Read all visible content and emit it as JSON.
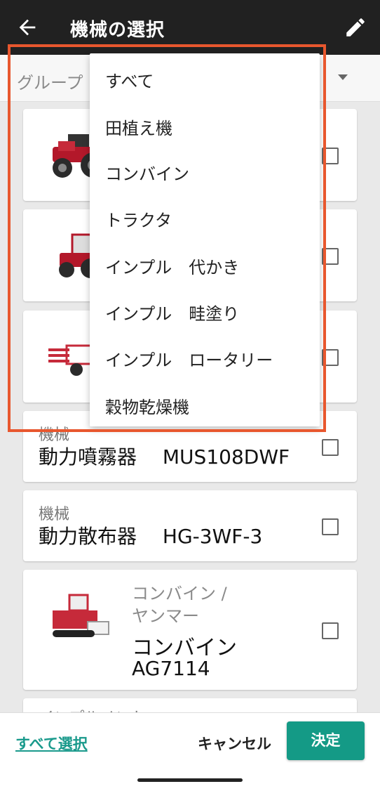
{
  "appbar": {
    "title": "機械の選択"
  },
  "filter": {
    "label": "グループ"
  },
  "cards": {
    "text1": {
      "category": "機械",
      "name": "動力噴霧器　 MUS108DWF"
    },
    "text2": {
      "category": "機械",
      "name": "動力散布器　 HG-3WF-3"
    },
    "combine": {
      "category_line1": "コンバイン /",
      "category_line2": "ヤンマー",
      "name_line1": "コンバイン",
      "name_line2": "AG7114"
    },
    "partial": {
      "category": "インプルメント"
    }
  },
  "dropdown": {
    "options": [
      "すべて",
      "田植え機",
      "コンバイン",
      "トラクタ",
      "インプル　代かき",
      "インプル　畦塗り",
      "インプル　ロータリー",
      "穀物乾燥機"
    ]
  },
  "bottom": {
    "select_all": "すべて選択",
    "cancel": "キャンセル",
    "confirm": "決定"
  },
  "icons": {
    "back": "arrow-left-icon",
    "edit": "pencil-icon",
    "dropdown": "caret-down-icon",
    "checkbox": "checkbox-icon"
  },
  "colors": {
    "appbar": "#212121",
    "accent": "#149a86",
    "highlight": "#e8572e"
  }
}
